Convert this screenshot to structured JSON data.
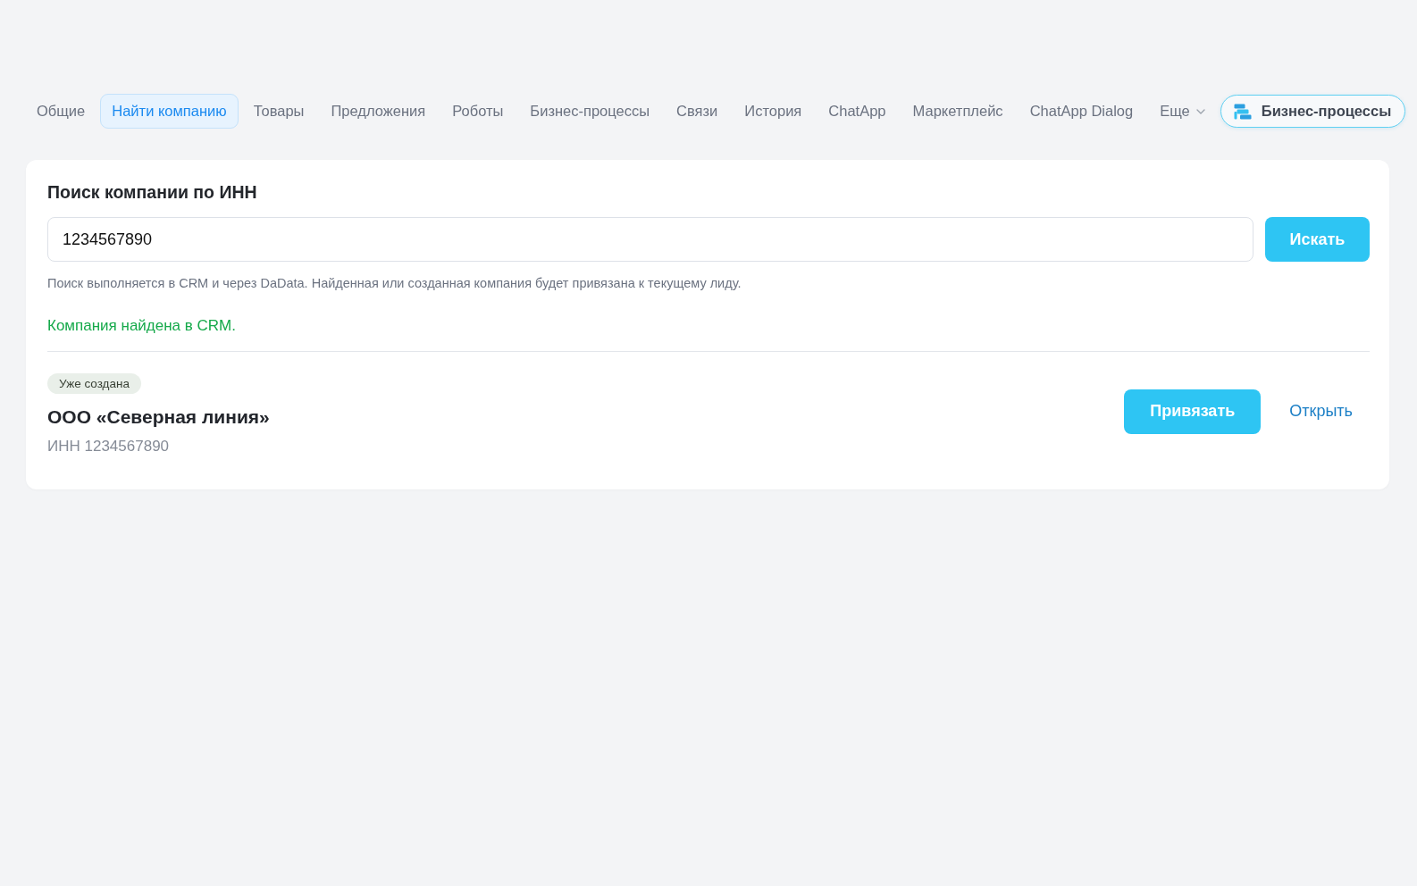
{
  "tabs": [
    {
      "label": "Общие",
      "selected": false,
      "kind": "plain"
    },
    {
      "label": "Найти компанию",
      "selected": true,
      "kind": "plain"
    },
    {
      "label": "Товары",
      "selected": false,
      "kind": "plain"
    },
    {
      "label": "Предложения",
      "selected": false,
      "kind": "plain"
    },
    {
      "label": "Роботы",
      "selected": false,
      "kind": "plain"
    },
    {
      "label": "Бизнес-процессы",
      "selected": false,
      "kind": "plain"
    },
    {
      "label": "Связи",
      "selected": false,
      "kind": "plain"
    },
    {
      "label": "История",
      "selected": false,
      "kind": "plain"
    },
    {
      "label": "ChatApp",
      "selected": false,
      "kind": "plain"
    },
    {
      "label": "Маркетплейс",
      "selected": false,
      "kind": "plain"
    },
    {
      "label": "ChatApp Dialog",
      "selected": false,
      "kind": "plain"
    },
    {
      "label": "Еще",
      "selected": false,
      "kind": "dropdown"
    }
  ],
  "action_button": {
    "label": "Бизнес-процессы"
  },
  "search_panel": {
    "title": "Поиск компании по ИНН",
    "field": {
      "value": "1234567890"
    },
    "button": "Искать",
    "hint": "Поиск выполняется в CRM и через DaData. Найденная или созданная компания будет привязана к текущему лиду.",
    "status": {
      "text": "Компания найдена в CRM.",
      "kind": "success"
    }
  },
  "result": {
    "badge": "Уже создана",
    "name": "ООО «Северная линия»",
    "inn": "ИНН 1234567890",
    "buttons": [
      {
        "label": "Привязать",
        "kind": "primary"
      },
      {
        "label": "Открыть",
        "kind": "link"
      }
    ]
  }
}
